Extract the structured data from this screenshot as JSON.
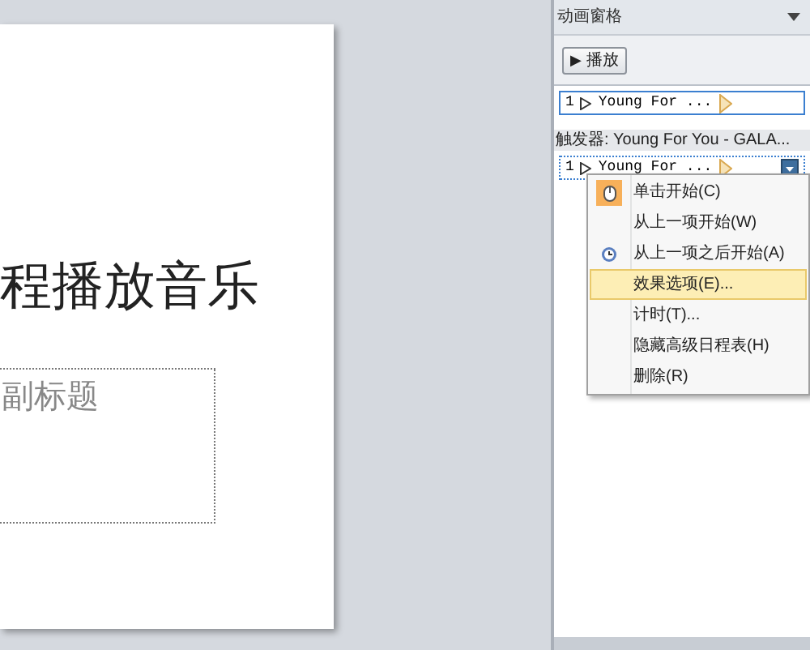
{
  "slide": {
    "title": "程播放音乐",
    "subtitle": "副标题"
  },
  "pane": {
    "title": "动画窗格",
    "play_button": {
      "icon": "▶",
      "label": "播放"
    },
    "items": [
      {
        "number": "1",
        "label": "Young For ...",
        "selected": false
      },
      {
        "kind": "trigger",
        "label": "触发器: Young For You - GALA..."
      },
      {
        "number": "1",
        "label": "Young For ...",
        "selected": true
      }
    ]
  },
  "context_menu": [
    {
      "label": "单击开始(C)",
      "kind": "mouse",
      "highlighted": false
    },
    {
      "label": "从上一项开始(W)",
      "kind": "plain",
      "highlighted": false
    },
    {
      "label": "从上一项之后开始(A)",
      "kind": "clock",
      "highlighted": false
    },
    {
      "label": "效果选项(E)...",
      "kind": "plain",
      "highlighted": true
    },
    {
      "label": "计时(T)...",
      "kind": "plain",
      "highlighted": false
    },
    {
      "label": "隐藏高级日程表(H)",
      "kind": "plain",
      "highlighted": false
    },
    {
      "label": "删除(R)",
      "kind": "plain",
      "highlighted": false
    }
  ]
}
